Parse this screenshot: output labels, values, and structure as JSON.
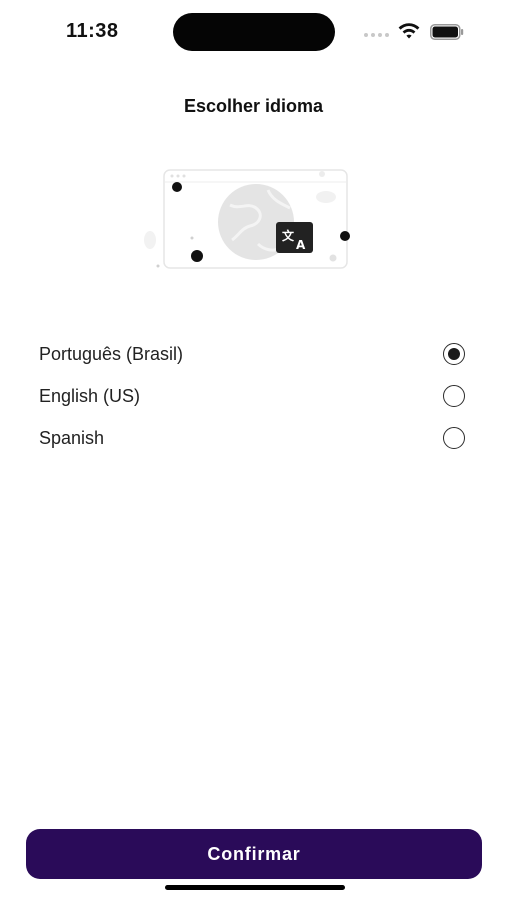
{
  "status_bar": {
    "time": "11:38",
    "icons": [
      "signal-icon",
      "wifi-icon",
      "battery-icon"
    ]
  },
  "page": {
    "title": "Escolher idioma"
  },
  "illustration": {
    "icon": "translate-icon",
    "subject": "globe-icon"
  },
  "languages": [
    {
      "label": "Português (Brasil)",
      "selected": true
    },
    {
      "label": "English (US)",
      "selected": false
    },
    {
      "label": "Spanish",
      "selected": false
    }
  ],
  "footer": {
    "confirm_label": "Confirmar"
  },
  "colors": {
    "accent": "#2a0b59",
    "background": "#ffffff",
    "text": "#222222"
  }
}
